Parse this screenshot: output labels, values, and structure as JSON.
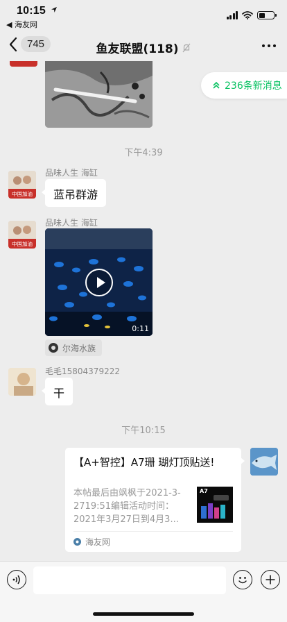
{
  "status_bar": {
    "time": "10:15",
    "back_app": "◀ 海友网"
  },
  "nav": {
    "unread_count": "745",
    "title": "鱼友联盟(118)"
  },
  "new_messages": {
    "label": "236条新消息"
  },
  "messages": {
    "time_1": "下午4:39",
    "sender_1": "品味人生 海缸",
    "text_1": "蓝吊群游",
    "sender_2": "品味人生 海缸",
    "video_duration": "0:11",
    "video_channel": "尔海水族",
    "sender_3": "毛毛15804379222",
    "text_3": "干",
    "time_2": "下午10:15"
  },
  "link_card": {
    "title": "【A+智控】A7珊 瑚灯顶贴送!",
    "description": "本帖最后由飒枫于2021-3-2719:51编辑活动时间：2021年3月27日到4月3...",
    "thumb_label": "A7",
    "source": "海友网"
  },
  "icons": {
    "location_arrow": "location-arrow-icon",
    "back": "chevron-left-icon",
    "mute": "mute-bell-icon",
    "more": "more-dots-icon",
    "voice": "voice-icon",
    "emoji": "emoji-icon",
    "add": "plus-icon"
  },
  "colors": {
    "accent_green": "#07c160",
    "chat_background": "#ededed",
    "bubble": "#ffffff"
  }
}
